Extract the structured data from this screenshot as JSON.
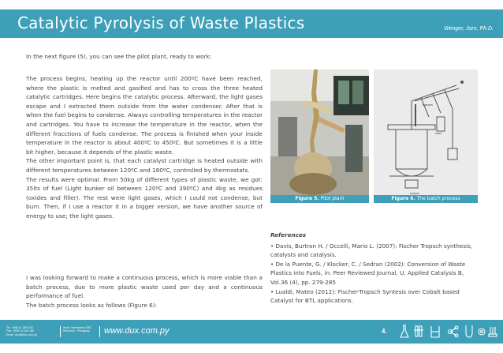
{
  "header": {
    "title": "Catalytic Pyrolysis of Waste Plastics",
    "author": "Wenger, Jorn, Ph.D."
  },
  "body": {
    "intro": "In the next figure (5), you can see the pilot plant, ready to work:",
    "p1": "The process begins, heating up the reactor until 200ºC have been reached, where the plastic is melted and gasified and has to cross the three heated catalytic cartridges. Here begins the catalytic process.  Afterward, the light gases escape and I extracted them outside from the water condenser. After that is when the fuel begins to condense. Always controlling temperatures in the reactor and cartridges. You have to increase the temperature in the reactor, when the different fracctions of fuels condense. The process is finished when your inside temperature in the reactor is about 400ºC to 450ºC. But sometimes it is a little bit higher, because it depends of the plastic waste.",
    "p2": "The other important point is, that each catalyst cartridge is heated outside with different temperatures between 120ºC and 180ºC, controlled by thermostats.",
    "p3": "The results were optimal. From 50kg of different types of plastic waste, we got: 35lts of fuel (Light bunker oil between 120ºC and 390ºC) and 4kg as residues (oxides and filler). The rest were light gases, which I could not condense, but burn. Then, if I use a reactor it in a bigger version, we have another source of energy to use; the light gases.",
    "p4": "I was looking forward to make a continuous process, which is more viable than a batch process, due to more plastic waste used per day and a continuous performance of fuel.",
    "p5": "The batch process looks as follows (Figure 6):"
  },
  "figures": {
    "fig5_label": "Figure 5.",
    "fig5_text": "Pilot plant",
    "fig6_label": "Figure 6.",
    "fig6_text": "The batch process"
  },
  "references": {
    "title": "References",
    "items": [
      "• Davis, Burtron H. / Occelli, Mario L. (2007): Fischer Tropsch synthesis, catalysts and catalysis.",
      "• De la Puente, G. / Klocker, C. / Sedran (2002): Conversion of Waste Plastics into Fuels, in:  Peer Reviewed Journal, U. Applied Catalysis B, Vol.36 (4), pp. 279-285",
      "• Lualdi, Mateo (2012): Fischer-Tropsch Syntesis over Cobalt based Catalyst for BTL applications."
    ]
  },
  "footer": {
    "contact_1": "Tel. +595 21 280 153",
    "contact_2": "Fax: +595 21 616 180",
    "contact_3": "Email: dux@dux.com.py",
    "addr_1": "Avda. Venezuela 2487",
    "addr_2": "Asunción - Paraguay",
    "url": "www.dux.com.py",
    "page": "4."
  },
  "colors": {
    "accent": "#3d9fb8",
    "text": "#444444"
  }
}
